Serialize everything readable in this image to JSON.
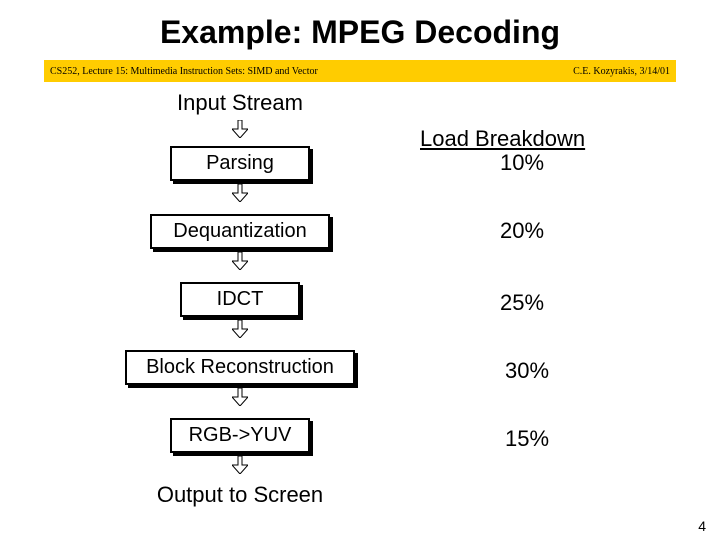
{
  "title": "Example: MPEG Decoding",
  "bar": {
    "left": "CS252, Lecture 15: Multimedia Instruction Sets: SIMD and Vector",
    "right": "C.E. Kozyrakis, 3/14/01"
  },
  "input_stream": "Input Stream",
  "load_heading": "Load Breakdown",
  "stages": {
    "parsing": {
      "label": "Parsing",
      "pct": "10%"
    },
    "dequant": {
      "label": "Dequantization",
      "pct": "20%"
    },
    "idct": {
      "label": "IDCT",
      "pct": "25%"
    },
    "block": {
      "label": "Block Reconstruction",
      "pct": "30%"
    },
    "rgbyuv": {
      "label": "RGB->YUV",
      "pct": "15%"
    }
  },
  "output": "Output to Screen",
  "page_number": "4"
}
